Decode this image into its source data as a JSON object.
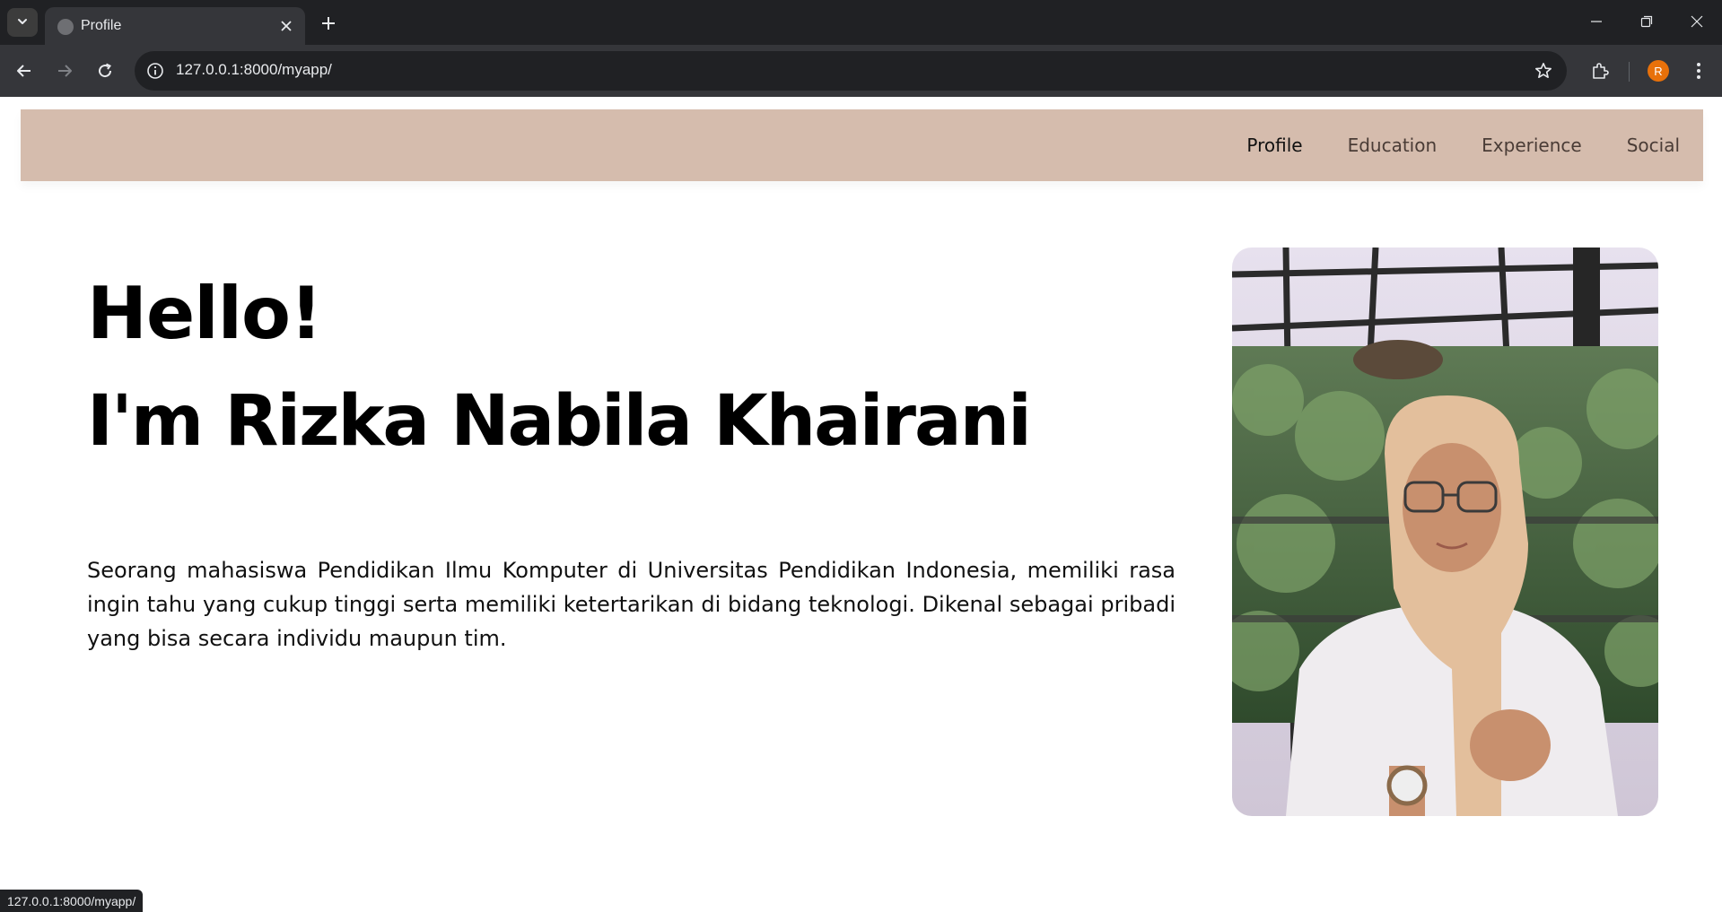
{
  "browser": {
    "tab": {
      "title": "Profile"
    },
    "address": {
      "url": "127.0.0.1:8000/myapp/"
    },
    "profile_initial": "R",
    "status_url": "127.0.0.1:8000/myapp/"
  },
  "nav": {
    "items": [
      {
        "label": "Profile",
        "active": true
      },
      {
        "label": "Education",
        "active": false
      },
      {
        "label": "Experience",
        "active": false
      },
      {
        "label": "Social",
        "active": false
      }
    ]
  },
  "hero": {
    "greeting": "Hello!",
    "name": "I'm Rizka Nabila Khairani",
    "description": "Seorang mahasiswa Pendidikan Ilmu Komputer di Universitas Pendidikan Indonesia, memiliki rasa ingin tahu yang cukup tinggi serta memiliki ketertarikan di bidang teknologi. Dikenal sebagai pribadi yang bisa secara individu maupun tim."
  },
  "colors": {
    "nav_background": "#d5bcad",
    "avatar": "#e8710a",
    "chrome_dark": "#202124",
    "chrome_toolbar": "#35363a"
  }
}
